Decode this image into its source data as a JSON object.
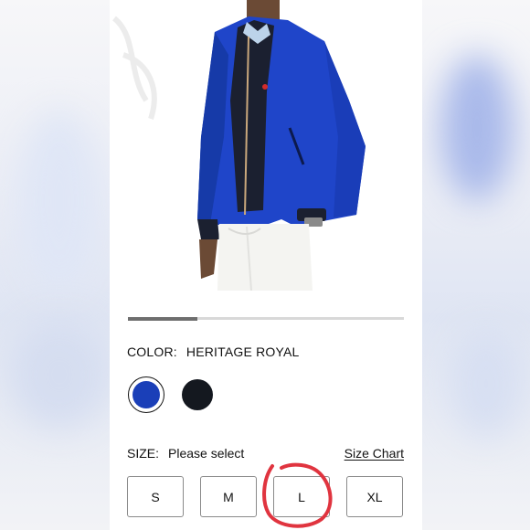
{
  "color": {
    "label": "COLOR:",
    "value": "HERITAGE ROYAL",
    "swatches": [
      {
        "name": "Heritage Royal",
        "hex": "#1a3fb8",
        "selected": true
      },
      {
        "name": "Navy",
        "hex": "#14181f",
        "selected": false
      }
    ]
  },
  "size": {
    "label": "SIZE:",
    "prompt": "Please select",
    "chart_link": "Size Chart",
    "options": [
      "S",
      "M",
      "L",
      "XL"
    ]
  },
  "carousel": {
    "progress": 0.25
  },
  "annotation": {
    "color": "#e0343f",
    "circled_option": "L"
  },
  "colors": {
    "jacket": "#1f45c9",
    "jacket_dark": "#142f95",
    "pants": "#f4f4f1",
    "navy": "#1b2030"
  }
}
